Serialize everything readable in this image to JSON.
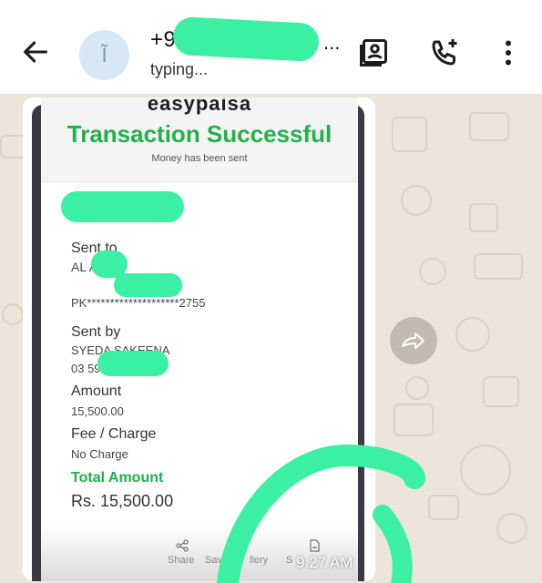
{
  "header": {
    "phone_start": "+9",
    "phone_ellipsis": "...",
    "status": "typing...",
    "avatar_letter": "Ĩ"
  },
  "receipt": {
    "brand": "easypaisa",
    "title": "Transaction Successful",
    "subtitle": "Money has been sent",
    "sent_to_label": "Sent to",
    "sent_to_name": "AL      ALI",
    "sent_to_account": "PK********************2755",
    "sent_by_label": "Sent by",
    "sent_by_name": "SYEDA SAKEENA",
    "sent_by_phone": "03         59",
    "amount_label": "Amount",
    "amount_value": "15,500.00",
    "fee_label": "Fee / Charge",
    "fee_value": "No Charge",
    "total_label": "Total Amount",
    "total_value": "Rs. 15,500.00",
    "actions": [
      "Share",
      "Save",
      "llery",
      "S"
    ]
  },
  "message": {
    "time": "9:27 AM"
  },
  "colors": {
    "accent_green": "#21b14b",
    "scribble": "#3bf0a2"
  },
  "icons": [
    "back-arrow-icon",
    "add-contact-icon",
    "add-call-icon",
    "more-vert-icon",
    "forward-icon",
    "share-icon",
    "save-icon"
  ]
}
